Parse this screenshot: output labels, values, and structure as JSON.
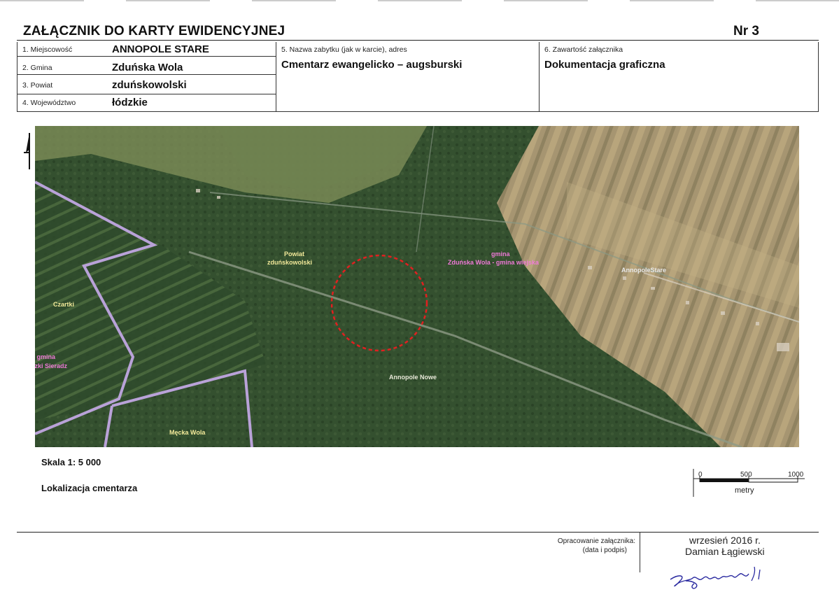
{
  "header": {
    "title": "ZAŁĄCZNIK DO KARTY EWIDENCYJNEJ",
    "number": "Nr 3"
  },
  "fields": {
    "miejscowosc_label": "1. Miejscowość",
    "miejscowosc_value": "ANNOPOLE STARE",
    "gmina_label": "2. Gmina",
    "gmina_value": "Zduńska Wola",
    "powiat_label": "3. Powiat",
    "powiat_value": "zduńskowolski",
    "wojewodztwo_label": "4. Województwo",
    "wojewodztwo_value": "łódzkie",
    "nazwa_label": "5. Nazwa zabytku (jak w karcie), adres",
    "nazwa_value": "Cmentarz ewangelicko – augsburski",
    "zawartosc_label": "6. Zawartość załącznika",
    "zawartosc_value": "Dokumentacja graficzna"
  },
  "map": {
    "labels": {
      "powiat": "Powiat",
      "powiat_name": "zduńskowolski",
      "gmina": "gmina",
      "gmina_name": "Zduńska Wola - gmina wiejska",
      "annopole_stare": "AnnopoleStare",
      "czartki": "Czartki",
      "gmina_sieradz_1": "at   gmina",
      "gmina_sieradz_2": "dzki  Sieradz",
      "annopole_nowe": "Annopole Nowe",
      "mecka_wola": "Męcka Wola"
    },
    "colors": {
      "forest": "#2f4a2a",
      "forest_light": "#47603b",
      "fields": "#a08f6a",
      "boundary": "#b9a2d8",
      "circle": "#e02020",
      "label_text": "#f3ea9a",
      "gmina_label": "#f07ad8"
    }
  },
  "scale": {
    "text": "Skala 1: 5 000",
    "bar_0": "0",
    "bar_500": "500",
    "bar_1000": "1000",
    "bar_unit": "metry"
  },
  "location_text": "Lokalizacja cmentarza",
  "footer": {
    "opracowanie_1": "Opracowanie załącznika:",
    "opracowanie_2": "(data i podpis)",
    "date": "wrzesień 2016 r.",
    "author": "Damian Łągiewski"
  }
}
